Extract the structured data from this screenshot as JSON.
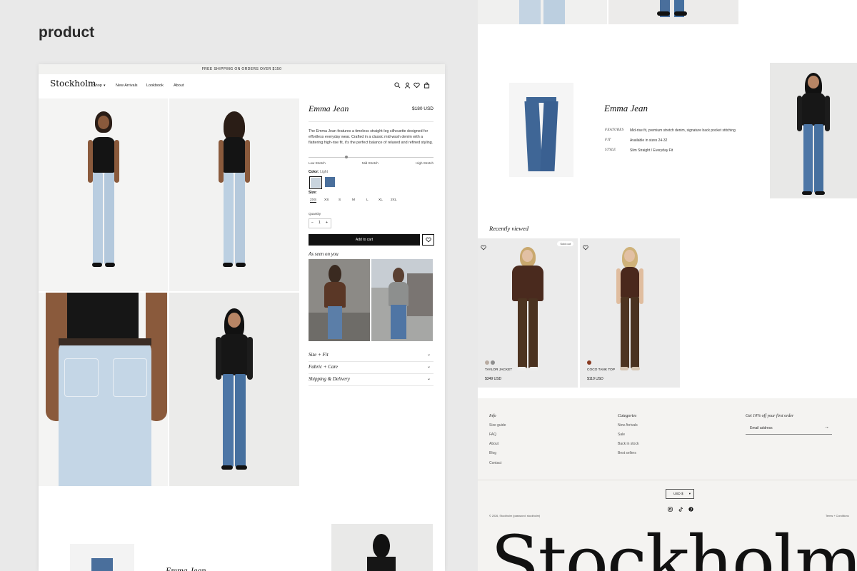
{
  "section_label": "product",
  "store": {
    "announcement": "FREE SHIPPING ON ORDERS OVER $150",
    "logo": "Stockholm",
    "nav": [
      "Shop",
      "New Arrivals",
      "Lookbook",
      "About"
    ]
  },
  "product": {
    "name": "Emma Jean",
    "price": "$180 USD",
    "description": "The Emma Jean features a timeless straight-leg silhouette designed for effortless everyday wear. Crafted in a classic mid-wash denim with a flattering high-rise fit, it's the perfect balance of relaxed and refined styling.",
    "stretch_labels": [
      "Low Stretch",
      "Mid Stretch",
      "High Stretch"
    ],
    "stretch_level": 0.3,
    "color_label": "Color:",
    "color_value": "Light",
    "colors": [
      "#c9d4de",
      "#4a6f9c"
    ],
    "size_label": "Size:",
    "sizes": [
      "2XS",
      "XS",
      "S",
      "M",
      "L",
      "XL",
      "2XL"
    ],
    "quantity_label": "Quantity",
    "quantity": "1",
    "minus": "−",
    "plus": "+",
    "add_to_cart": "Add to cart",
    "seen_on_you": "As seen on you",
    "accordions": [
      "Size + Fit",
      "Fabric + Care",
      "Shipping & Delivery"
    ]
  },
  "feature_block": {
    "title": "Emma Jean",
    "rows": [
      {
        "key": "FEATURES",
        "value": "Mid-rise fit, premium stretch denim, signature back pocket stitching"
      },
      {
        "key": "FIT",
        "value": "Available in sizes 24-32"
      },
      {
        "key": "STYLE",
        "value": "Slim Straight / Everyday Fit"
      }
    ]
  },
  "recently_viewed": {
    "title": "Recently viewed",
    "items": [
      {
        "name": "TAYLOR JACKET",
        "price": "$349 USD",
        "badge": "Sold out",
        "dots": [
          "#b9aca2",
          "#8f8f8f"
        ]
      },
      {
        "name": "COCO TANK TOP",
        "price": "$110 USD",
        "badge": "",
        "dots": [
          "#8a3b22"
        ]
      }
    ]
  },
  "footer": {
    "info_title": "Info",
    "info_links": [
      "Size guide",
      "FAQ",
      "About",
      "Blog",
      "Contact"
    ],
    "categories_title": "Categories",
    "category_links": [
      "New Arrivals",
      "Sale",
      "Back in stock",
      "Best sellers"
    ],
    "newsletter_title": "Get 10% off your first order",
    "email_placeholder": "Email address",
    "currency": "USD $",
    "copyright": "© 2026, Stockholm (password: stockholm)",
    "terms": "Terms + Conditions",
    "big_logo": "Stockholm"
  },
  "lower_preview": {
    "title": "Emma Jean"
  }
}
